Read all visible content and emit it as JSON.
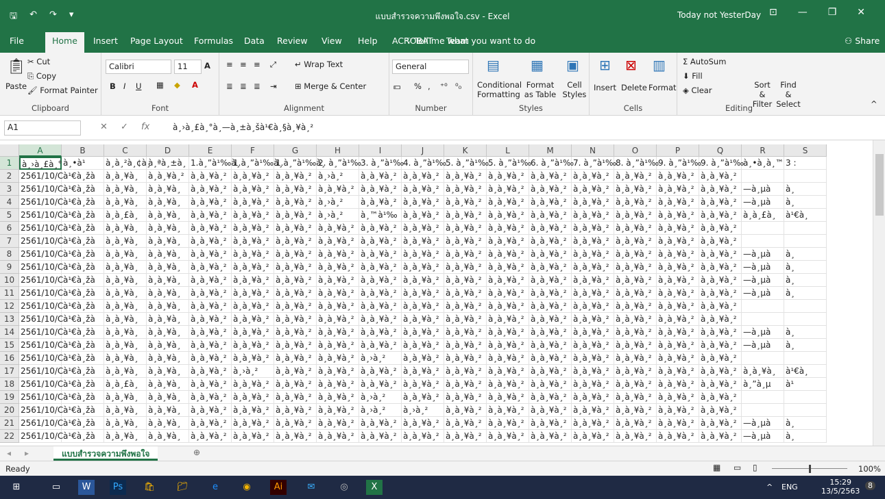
{
  "window": {
    "title": "แบบสำรวจความพึงพอใจ.csv  -  Excel",
    "user": "Today not YesterDay",
    "quick_save": "🖫",
    "quick_undo": "↶",
    "quick_redo": "↷",
    "quick_more": "▾"
  },
  "tabs": [
    "File",
    "Home",
    "Insert",
    "Page Layout",
    "Formulas",
    "Data",
    "Review",
    "View",
    "Help",
    "ACROBAT",
    "Team"
  ],
  "tellme": "Tell me what you want to do",
  "share": "Share",
  "ribbon": {
    "clipboard": {
      "paste": "Paste",
      "cut": "Cut",
      "copy": "Copy",
      "format_painter": "Format Painter",
      "label": "Clipboard"
    },
    "font": {
      "name": "Calibri",
      "size": "11",
      "label": "Font"
    },
    "alignment": {
      "wrap": "Wrap Text",
      "merge": "Merge & Center",
      "label": "Alignment"
    },
    "number": {
      "format": "General",
      "label": "Number"
    },
    "styles": {
      "conditional": "Conditional Formatting",
      "format_as": "Format as Table",
      "cell_styles": "Cell Styles",
      "label": "Styles"
    },
    "cells": {
      "insert": "Insert",
      "delete": "Delete",
      "format": "Format",
      "label": "Cells"
    },
    "editing": {
      "autosum": "AutoSum",
      "fill": "Fill",
      "clear": "Clear",
      "sort": "Sort & Filter",
      "find": "Find & Select",
      "label": "Editing"
    }
  },
  "formula": {
    "namebox": "A1",
    "content": "à¸›à¸£à¸°à¸—à¸±à¸šà¹€à¸§à¸¥à¸²"
  },
  "columns": [
    "A",
    "B",
    "C",
    "D",
    "E",
    "F",
    "G",
    "H",
    "I",
    "J",
    "K",
    "L",
    "M",
    "N",
    "O",
    "P",
    "Q",
    "R",
    "S"
  ],
  "rows": [
    [
      "à¸›à¸£à¸°",
      "à¸•à¹",
      "à¸à¸²à¸¢à¸",
      "à¸ªà¸±à¸",
      "1.à¸”à¹‰à¸",
      "1.à¸”à¹‰à¸",
      "1.à¸”à¹‰à¸",
      "2. à¸”à¹‰",
      "3. à¸”à¹‰",
      "4. à¸”à¹‰",
      "5. à¸”à¹‰",
      "5. à¸”à¹‰",
      "6. à¸”à¹‰",
      "7. à¸”à¹‰",
      "8. à¸”à¹‰",
      "9. à¸”à¹‰",
      "9. à¸”à¹‰",
      "à¸•à¸à¸™",
      "3 :"
    ],
    [
      "2561/10/C",
      "à¹€à¸žà",
      "à¸à¸¥à¸",
      "à¸à¸¥à¸²",
      "à¸à¸¥à¸²",
      "à¸à¸¥à¸²",
      "à¸à¸¥à¸²",
      "à¸›à¸²",
      "à¸à¸¥à¸²",
      "à¸à¸¥à¸²",
      "à¸à¸¥à¸²",
      "à¸à¸¥à¸²",
      "à¸à¸¥à¸²",
      "à¸à¸¥à¸²",
      "à¸à¸¥à¸²",
      "à¸à¸¥à¸²",
      "à¸à¸¥à¸²",
      "",
      ""
    ],
    [
      "2561/10/C",
      "à¹€à¸žà",
      "à¸à¸¥à¸",
      "à¸à¸¥à¸",
      "à¸à¸¥à¸²",
      "à¸à¸¥à¸²",
      "à¸à¸¥à¸²",
      "à¸à¸¥à¸²",
      "à¸à¸¥à¸²",
      "à¸à¸¥à¸²",
      "à¸à¸¥à¸²",
      "à¸à¸¥à¸²",
      "à¸à¸¥à¸²",
      "à¸à¸¥à¸²",
      "à¸à¸¥à¸²",
      "à¸à¸¥à¸²",
      "à¸à¸¥à¸²",
      "—à¸µà",
      "à¸"
    ],
    [
      "2561/10/C",
      "à¹€à¸žà",
      "à¸à¸¥à¸",
      "à¸à¸¥à¸",
      "à¸à¸¥à¸²",
      "à¸à¸¥à¸²",
      "à¸à¸¥à¸²",
      "à¸›à¸²",
      "à¸à¸¥à¸²",
      "à¸à¸¥à¸²",
      "à¸à¸¥à¸²",
      "à¸à¸¥à¸²",
      "à¸à¸¥à¸²",
      "à¸à¸¥à¸²",
      "à¸à¸¥à¸²",
      "à¸à¸¥à¸²",
      "à¸à¸¥à¸²",
      "—à¸µà",
      "à¸"
    ],
    [
      "2561/10/C",
      "à¹€à¸žà",
      "à¸à¸£à¸",
      "à¸à¸¥à¸",
      "à¸à¸¥à¸²",
      "à¸à¸¥à¸²",
      "à¸à¸¥à¸²",
      "à¸›à¸²",
      "à¸™à¹‰",
      "à¸à¸¥à¸²",
      "à¸à¸¥à¸²",
      "à¸à¸¥à¸²",
      "à¸à¸¥à¸²",
      "à¸à¸¥à¸²",
      "à¸à¸¥à¸²",
      "à¸à¸¥à¸²",
      "à¸à¸¥à¸²",
      "à¸à¸£à¸",
      "à¹€à¸"
    ],
    [
      "2561/10/C",
      "à¹€à¸žà",
      "à¸à¸¥à¸",
      "à¸à¸¥à¸",
      "à¸à¸¥à¸²",
      "à¸à¸¥à¸²",
      "à¸à¸¥à¸²",
      "à¸à¸¥à¸²",
      "à¸à¸¥à¸²",
      "à¸à¸¥à¸²",
      "à¸à¸¥à¸²",
      "à¸à¸¥à¸²",
      "à¸à¸¥à¸²",
      "à¸à¸¥à¸²",
      "à¸à¸¥à¸²",
      "à¸à¸¥à¸²",
      "à¸à¸¥à¸²",
      "",
      ""
    ],
    [
      "2561/10/C",
      "à¹€à¸žà",
      "à¸à¸¥à¸",
      "à¸à¸¥à¸",
      "à¸à¸¥à¸²",
      "à¸à¸¥à¸²",
      "à¸à¸¥à¸²",
      "à¸à¸¥à¸²",
      "à¸à¸¥à¸²",
      "à¸à¸¥à¸²",
      "à¸à¸¥à¸²",
      "à¸à¸¥à¸²",
      "à¸à¸¥à¸²",
      "à¸à¸¥à¸²",
      "à¸à¸¥à¸²",
      "à¸à¸¥à¸²",
      "à¸à¸¥à¸²",
      "",
      ""
    ],
    [
      "2561/10/C",
      "à¹€à¸žà",
      "à¸à¸¥à¸",
      "à¸à¸¥à¸",
      "à¸à¸¥à¸²",
      "à¸à¸¥à¸²",
      "à¸à¸¥à¸²",
      "à¸à¸¥à¸²",
      "à¸à¸¥à¸²",
      "à¸à¸¥à¸²",
      "à¸à¸¥à¸²",
      "à¸à¸¥à¸²",
      "à¸à¸¥à¸²",
      "à¸à¸¥à¸²",
      "à¸à¸¥à¸²",
      "à¸à¸¥à¸²",
      "à¸à¸¥à¸²",
      "—à¸µà",
      "à¸"
    ],
    [
      "2561/10/C",
      "à¹€à¸žà",
      "à¸à¸¥à¸",
      "à¸à¸¥à¸",
      "à¸à¸¥à¸²",
      "à¸à¸¥à¸²",
      "à¸à¸¥à¸²",
      "à¸à¸¥à¸²",
      "à¸à¸¥à¸²",
      "à¸à¸¥à¸²",
      "à¸à¸¥à¸²",
      "à¸à¸¥à¸²",
      "à¸à¸¥à¸²",
      "à¸à¸¥à¸²",
      "à¸à¸¥à¸²",
      "à¸à¸¥à¸²",
      "à¸à¸¥à¸²",
      "—à¸µà",
      "à¸"
    ],
    [
      "2561/10/C",
      "à¹€à¸žà",
      "à¸à¸¥à¸",
      "à¸à¸¥à¸",
      "à¸à¸¥à¸²",
      "à¸à¸¥à¸²",
      "à¸à¸¥à¸²",
      "à¸à¸¥à¸²",
      "à¸à¸¥à¸²",
      "à¸à¸¥à¸²",
      "à¸à¸¥à¸²",
      "à¸à¸¥à¸²",
      "à¸à¸¥à¸²",
      "à¸à¸¥à¸²",
      "à¸à¸¥à¸²",
      "à¸à¸¥à¸²",
      "à¸à¸¥à¸²",
      "—à¸µà",
      "à¸"
    ],
    [
      "2561/10/C",
      "à¹€à¸žà",
      "à¸à¸¥à¸",
      "à¸à¸¥à¸",
      "à¸à¸¥à¸²",
      "à¸à¸¥à¸²",
      "à¸à¸¥à¸²",
      "à¸à¸¥à¸²",
      "à¸à¸¥à¸²",
      "à¸à¸¥à¸²",
      "à¸à¸¥à¸²",
      "à¸à¸¥à¸²",
      "à¸à¸¥à¸²",
      "à¸à¸¥à¸²",
      "à¸à¸¥à¸²",
      "à¸à¸¥à¸²",
      "à¸à¸¥à¸²",
      "—à¸µà",
      "à¸"
    ],
    [
      "2561/10/C",
      "à¹€à¸žà",
      "à¸à¸¥à¸",
      "à¸à¸¥à¸",
      "à¸à¸¥à¸²",
      "à¸à¸¥à¸²",
      "à¸à¸¥à¸²",
      "à¸à¸¥à¸²",
      "à¸à¸¥à¸²",
      "à¸à¸¥à¸²",
      "à¸à¸¥à¸²",
      "à¸à¸¥à¸²",
      "à¸à¸¥à¸²",
      "à¸à¸¥à¸²",
      "à¸à¸¥à¸²",
      "à¸à¸¥à¸²",
      "à¸à¸¥à¸²",
      "",
      ""
    ],
    [
      "2561/10/C",
      "à¹€à¸žà",
      "à¸à¸¥à¸",
      "à¸à¸¥à¸",
      "à¸à¸¥à¸²",
      "à¸à¸¥à¸²",
      "à¸à¸¥à¸²",
      "à¸à¸¥à¸²",
      "à¸à¸¥à¸²",
      "à¸à¸¥à¸²",
      "à¸à¸¥à¸²",
      "à¸à¸¥à¸²",
      "à¸à¸¥à¸²",
      "à¸à¸¥à¸²",
      "à¸à¸¥à¸²",
      "à¸à¸¥à¸²",
      "à¸à¸¥à¸²",
      "",
      ""
    ],
    [
      "2561/10/C",
      "à¹€à¸žà",
      "à¸à¸¥à¸",
      "à¸à¸¥à¸",
      "à¸à¸¥à¸²",
      "à¸à¸¥à¸²",
      "à¸à¸¥à¸²",
      "à¸à¸¥à¸²",
      "à¸à¸¥à¸²",
      "à¸à¸¥à¸²",
      "à¸à¸¥à¸²",
      "à¸à¸¥à¸²",
      "à¸à¸¥à¸²",
      "à¸à¸¥à¸²",
      "à¸à¸¥à¸²",
      "à¸à¸¥à¸²",
      "à¸à¸¥à¸²",
      "—à¸µà",
      "à¸"
    ],
    [
      "2561/10/C",
      "à¹€à¸žà",
      "à¸à¸¥à¸",
      "à¸à¸¥à¸",
      "à¸à¸¥à¸²",
      "à¸à¸¥à¸²",
      "à¸à¸¥à¸²",
      "à¸à¸¥à¸²",
      "à¸à¸¥à¸²",
      "à¸à¸¥à¸²",
      "à¸à¸¥à¸²",
      "à¸à¸¥à¸²",
      "à¸à¸¥à¸²",
      "à¸à¸¥à¸²",
      "à¸à¸¥à¸²",
      "à¸à¸¥à¸²",
      "à¸à¸¥à¸²",
      "—à¸µà",
      "à¸"
    ],
    [
      "2561/10/C",
      "à¹€à¸žà",
      "à¸à¸¥à¸",
      "à¸à¸¥à¸",
      "à¸à¸¥à¸²",
      "à¸à¸¥à¸²",
      "à¸à¸¥à¸²",
      "à¸à¸¥à¸²",
      "à¸›à¸²",
      "à¸à¸¥à¸²",
      "à¸à¸¥à¸²",
      "à¸à¸¥à¸²",
      "à¸à¸¥à¸²",
      "à¸à¸¥à¸²",
      "à¸à¸¥à¸²",
      "à¸à¸¥à¸²",
      "à¸à¸¥à¸²",
      "",
      ""
    ],
    [
      "2561/10/C",
      "à¹€à¸žà",
      "à¸à¸¥à¸",
      "à¸à¸¥à¸",
      "à¸à¸¥à¸²",
      "à¸›à¸²",
      "à¸à¸¥à¸²",
      "à¸à¸¥à¸²",
      "à¸à¸¥à¸²",
      "à¸à¸¥à¸²",
      "à¸à¸¥à¸²",
      "à¸à¸¥à¸²",
      "à¸à¸¥à¸²",
      "à¸à¸¥à¸²",
      "à¸à¸¥à¸²",
      "à¸à¸¥à¸²",
      "à¸à¸¥à¸²",
      "à¸à¸¥à¸",
      "à¹€à¸"
    ],
    [
      "2561/10/C",
      "à¹€à¸žà",
      "à¸à¸£à¸",
      "à¸à¸¥à¸",
      "à¸à¸¥à¸²",
      "à¸à¸¥à¸²",
      "à¸à¸¥à¸²",
      "à¸à¸¥à¸²",
      "à¸à¸¥à¸²",
      "à¸à¸¥à¸²",
      "à¸à¸¥à¸²",
      "à¸à¸¥à¸²",
      "à¸à¸¥à¸²",
      "à¸à¸¥à¸²",
      "à¸à¸¥à¸²",
      "à¸à¸¥à¸²",
      "à¸à¸¥à¸²",
      "à¸”à¸µ",
      "à¹"
    ],
    [
      "2561/10/C",
      "à¹€à¸žà",
      "à¸à¸¥à¸",
      "à¸à¸¥à¸",
      "à¸à¸¥à¸²",
      "à¸à¸¥à¸²",
      "à¸à¸¥à¸²",
      "à¸à¸¥à¸²",
      "à¸›à¸²",
      "à¸à¸¥à¸²",
      "à¸à¸¥à¸²",
      "à¸à¸¥à¸²",
      "à¸à¸¥à¸²",
      "à¸à¸¥à¸²",
      "à¸à¸¥à¸²",
      "à¸à¸¥à¸²",
      "à¸à¸¥à¸²",
      "",
      ""
    ],
    [
      "2561/10/C",
      "à¹€à¸žà",
      "à¸à¸¥à¸",
      "à¸à¸¥à¸",
      "à¸à¸¥à¸²",
      "à¸à¸¥à¸²",
      "à¸à¸¥à¸²",
      "à¸à¸¥à¸²",
      "à¸›à¸²",
      "à¸›à¸²",
      "à¸à¸¥à¸²",
      "à¸à¸¥à¸²",
      "à¸à¸¥à¸²",
      "à¸à¸¥à¸²",
      "à¸à¸¥à¸²",
      "à¸à¸¥à¸²",
      "à¸à¸¥à¸²",
      "",
      ""
    ],
    [
      "2561/10/C",
      "à¹€à¸žà",
      "à¸à¸¥à¸",
      "à¸à¸¥à¸",
      "à¸à¸¥à¸²",
      "à¸à¸¥à¸²",
      "à¸à¸¥à¸²",
      "à¸à¸¥à¸²",
      "à¸à¸¥à¸²",
      "à¸à¸¥à¸²",
      "à¸à¸¥à¸²",
      "à¸à¸¥à¸²",
      "à¸à¸¥à¸²",
      "à¸à¸¥à¸²",
      "à¸à¸¥à¸²",
      "à¸à¸¥à¸²",
      "à¸à¸¥à¸²",
      "—à¸µà",
      "à¸"
    ],
    [
      "2561/10/C",
      "à¹€à¸žà",
      "à¸à¸¥à¸",
      "à¸à¸¥à¸",
      "à¸à¸¥à¸²",
      "à¸à¸¥à¸²",
      "à¸à¸¥à¸²",
      "à¸à¸¥à¸²",
      "à¸à¸¥à¸²",
      "à¸à¸¥à¸²",
      "à¸à¸¥à¸²",
      "à¸à¸¥à¸²",
      "à¸à¸¥à¸²",
      "à¸à¸¥à¸²",
      "à¸à¸¥à¸²",
      "à¸à¸¥à¸²",
      "à¸à¸¥à¸²",
      "—à¸µà",
      "à¸"
    ]
  ],
  "sheet": {
    "name": "แบบสำรวจความพึงพอใจ",
    "add": "⊕"
  },
  "status": {
    "ready": "Ready",
    "zoom": "100%"
  },
  "taskbar": {
    "lang": "ENG",
    "time": "15:29",
    "date": "13/5/2563",
    "badge": "8"
  }
}
